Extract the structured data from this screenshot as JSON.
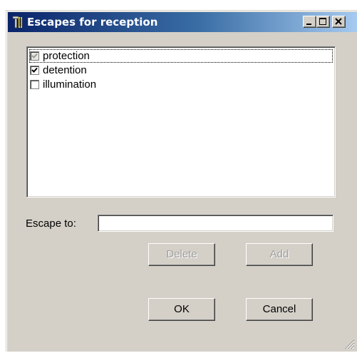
{
  "window": {
    "title": "Escapes for reception",
    "icon": "app-tool-icon",
    "controls": [
      "minimize-icon",
      "maximize-icon",
      "close-icon"
    ]
  },
  "list": {
    "items": [
      {
        "label": "protection",
        "checked": true,
        "disabled": true,
        "focused": true
      },
      {
        "label": "detention",
        "checked": true,
        "disabled": false,
        "focused": false
      },
      {
        "label": "illumination",
        "checked": false,
        "disabled": false,
        "focused": false
      }
    ]
  },
  "escape_field": {
    "label": "Escape to:",
    "value": "",
    "placeholder": ""
  },
  "buttons": {
    "delete": {
      "label": "Delete",
      "enabled": false
    },
    "add": {
      "label": "Add",
      "enabled": false
    },
    "ok": {
      "label": "OK",
      "enabled": true
    },
    "cancel": {
      "label": "Cancel",
      "enabled": true
    }
  },
  "colors": {
    "titlebar_start": "#0a246a",
    "titlebar_end": "#a6caf0",
    "face": "#d4d0c8"
  }
}
